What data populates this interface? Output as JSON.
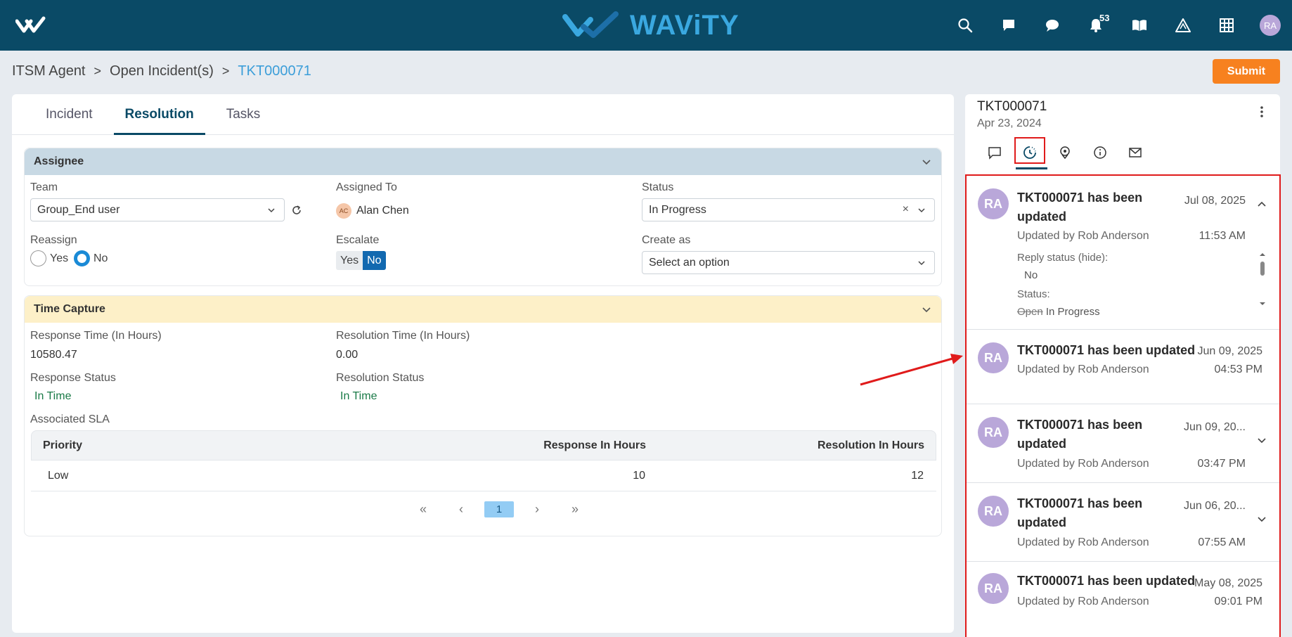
{
  "app": {
    "brand": "WAViTY",
    "notification_count": "53",
    "user_initials": "RA"
  },
  "top_icons": [
    "search-icon",
    "chat-icon",
    "comment-icon",
    "bell-icon",
    "book-icon",
    "alert-icon",
    "grid-icon"
  ],
  "breadcrumb": {
    "root": "ITSM Agent",
    "sep": ">",
    "middle": "Open Incident(s)",
    "current": "TKT000071"
  },
  "actions": {
    "submit": "Submit"
  },
  "tabs": [
    "Incident",
    "Resolution",
    "Tasks"
  ],
  "assignee": {
    "title": "Assignee",
    "team_label": "Team",
    "team_value": "Group_End user",
    "assigned_label": "Assigned To",
    "assigned_initials": "AC",
    "assigned_value": "Alan Chen",
    "status_label": "Status",
    "status_value": "In Progress",
    "reassign_label": "Reassign",
    "yes": "Yes",
    "no": "No",
    "escalate_label": "Escalate",
    "create_label": "Create as",
    "create_placeholder": "Select an option"
  },
  "time_capture": {
    "title": "Time Capture",
    "response_time_label": "Response Time (In Hours)",
    "response_time": "10580.47",
    "resolution_time_label": "Resolution Time (In Hours)",
    "resolution_time": "0.00",
    "response_status_label": "Response Status",
    "response_status": "In Time",
    "resolution_status_label": "Resolution Status",
    "resolution_status": "In Time",
    "sla_label": "Associated SLA",
    "sla_headers": [
      "Priority",
      "Response In Hours",
      "Resolution In Hours"
    ],
    "sla_row": [
      "Low",
      "10",
      "12"
    ],
    "pager": {
      "first": "«",
      "prev": "‹",
      "page": "1",
      "next": "›",
      "last": "»"
    }
  },
  "right_panel": {
    "ticket": "TKT000071",
    "date": "Apr 23, 2024",
    "feed": [
      {
        "initials": "RA",
        "title": "TKT000071 has been updated",
        "by": "Updated by Rob Anderson",
        "date": "Jul 08, 2025",
        "time": "11:53 AM",
        "details": {
          "reply_label": "Reply status (hide):",
          "reply_value": "No",
          "status_label": "Status:",
          "status_old": "Open",
          "status_new": "In Progress"
        }
      },
      {
        "initials": "RA",
        "title": "TKT000071 has been updated",
        "by": "Updated by Rob Anderson",
        "date": "Jun 09, 2025",
        "time": "04:53 PM"
      },
      {
        "initials": "RA",
        "title": "TKT000071 has been updated",
        "by": "Updated by Rob Anderson",
        "date": "Jun 09, 20...",
        "time": "03:47 PM"
      },
      {
        "initials": "RA",
        "title": "TKT000071 has been updated",
        "by": "Updated by Rob Anderson",
        "date": "Jun 06, 20...",
        "time": "07:55 AM"
      },
      {
        "initials": "RA",
        "title": "TKT000071 has been updated",
        "by": "Updated by Rob Anderson",
        "date": "May 08, 2025",
        "time": "09:01 PM"
      }
    ]
  },
  "colors": {
    "topbar": "#0a4a66",
    "accent": "#3aa8e0",
    "submit": "#f7811f",
    "highlight": "#e01b1b"
  }
}
